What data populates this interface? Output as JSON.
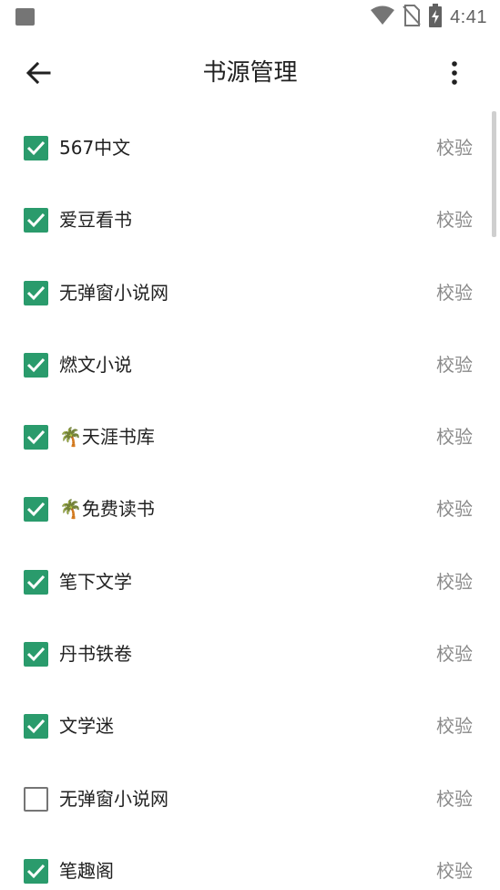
{
  "status_bar": {
    "time": "4:41",
    "icons": [
      "notification-square-icon",
      "wifi-icon",
      "no-sim-icon",
      "battery-charging-icon"
    ]
  },
  "app_bar": {
    "title": "书源管理",
    "back_icon": "arrow-left-icon",
    "menu_icon": "more-vertical-icon"
  },
  "colors": {
    "accent": "#2a9b6c",
    "text_primary": "#212121",
    "text_secondary": "#8a8a8a",
    "checkbox_unchecked": "#757575"
  },
  "sources": [
    {
      "name": "567中文",
      "checked": true,
      "action": "校验"
    },
    {
      "name": "爱豆看书",
      "checked": true,
      "action": "校验"
    },
    {
      "name": "无弹窗小说网",
      "checked": true,
      "action": "校验"
    },
    {
      "name": "燃文小说",
      "checked": true,
      "action": "校验"
    },
    {
      "name": "🌴天涯书库",
      "checked": true,
      "action": "校验"
    },
    {
      "name": "🌴免费读书",
      "checked": true,
      "action": "校验"
    },
    {
      "name": "笔下文学",
      "checked": true,
      "action": "校验"
    },
    {
      "name": "丹书铁卷",
      "checked": true,
      "action": "校验"
    },
    {
      "name": "文学迷",
      "checked": true,
      "action": "校验"
    },
    {
      "name": "无弹窗小说网",
      "checked": false,
      "action": "校验"
    },
    {
      "name": "笔趣阁",
      "checked": true,
      "action": "校验"
    }
  ]
}
